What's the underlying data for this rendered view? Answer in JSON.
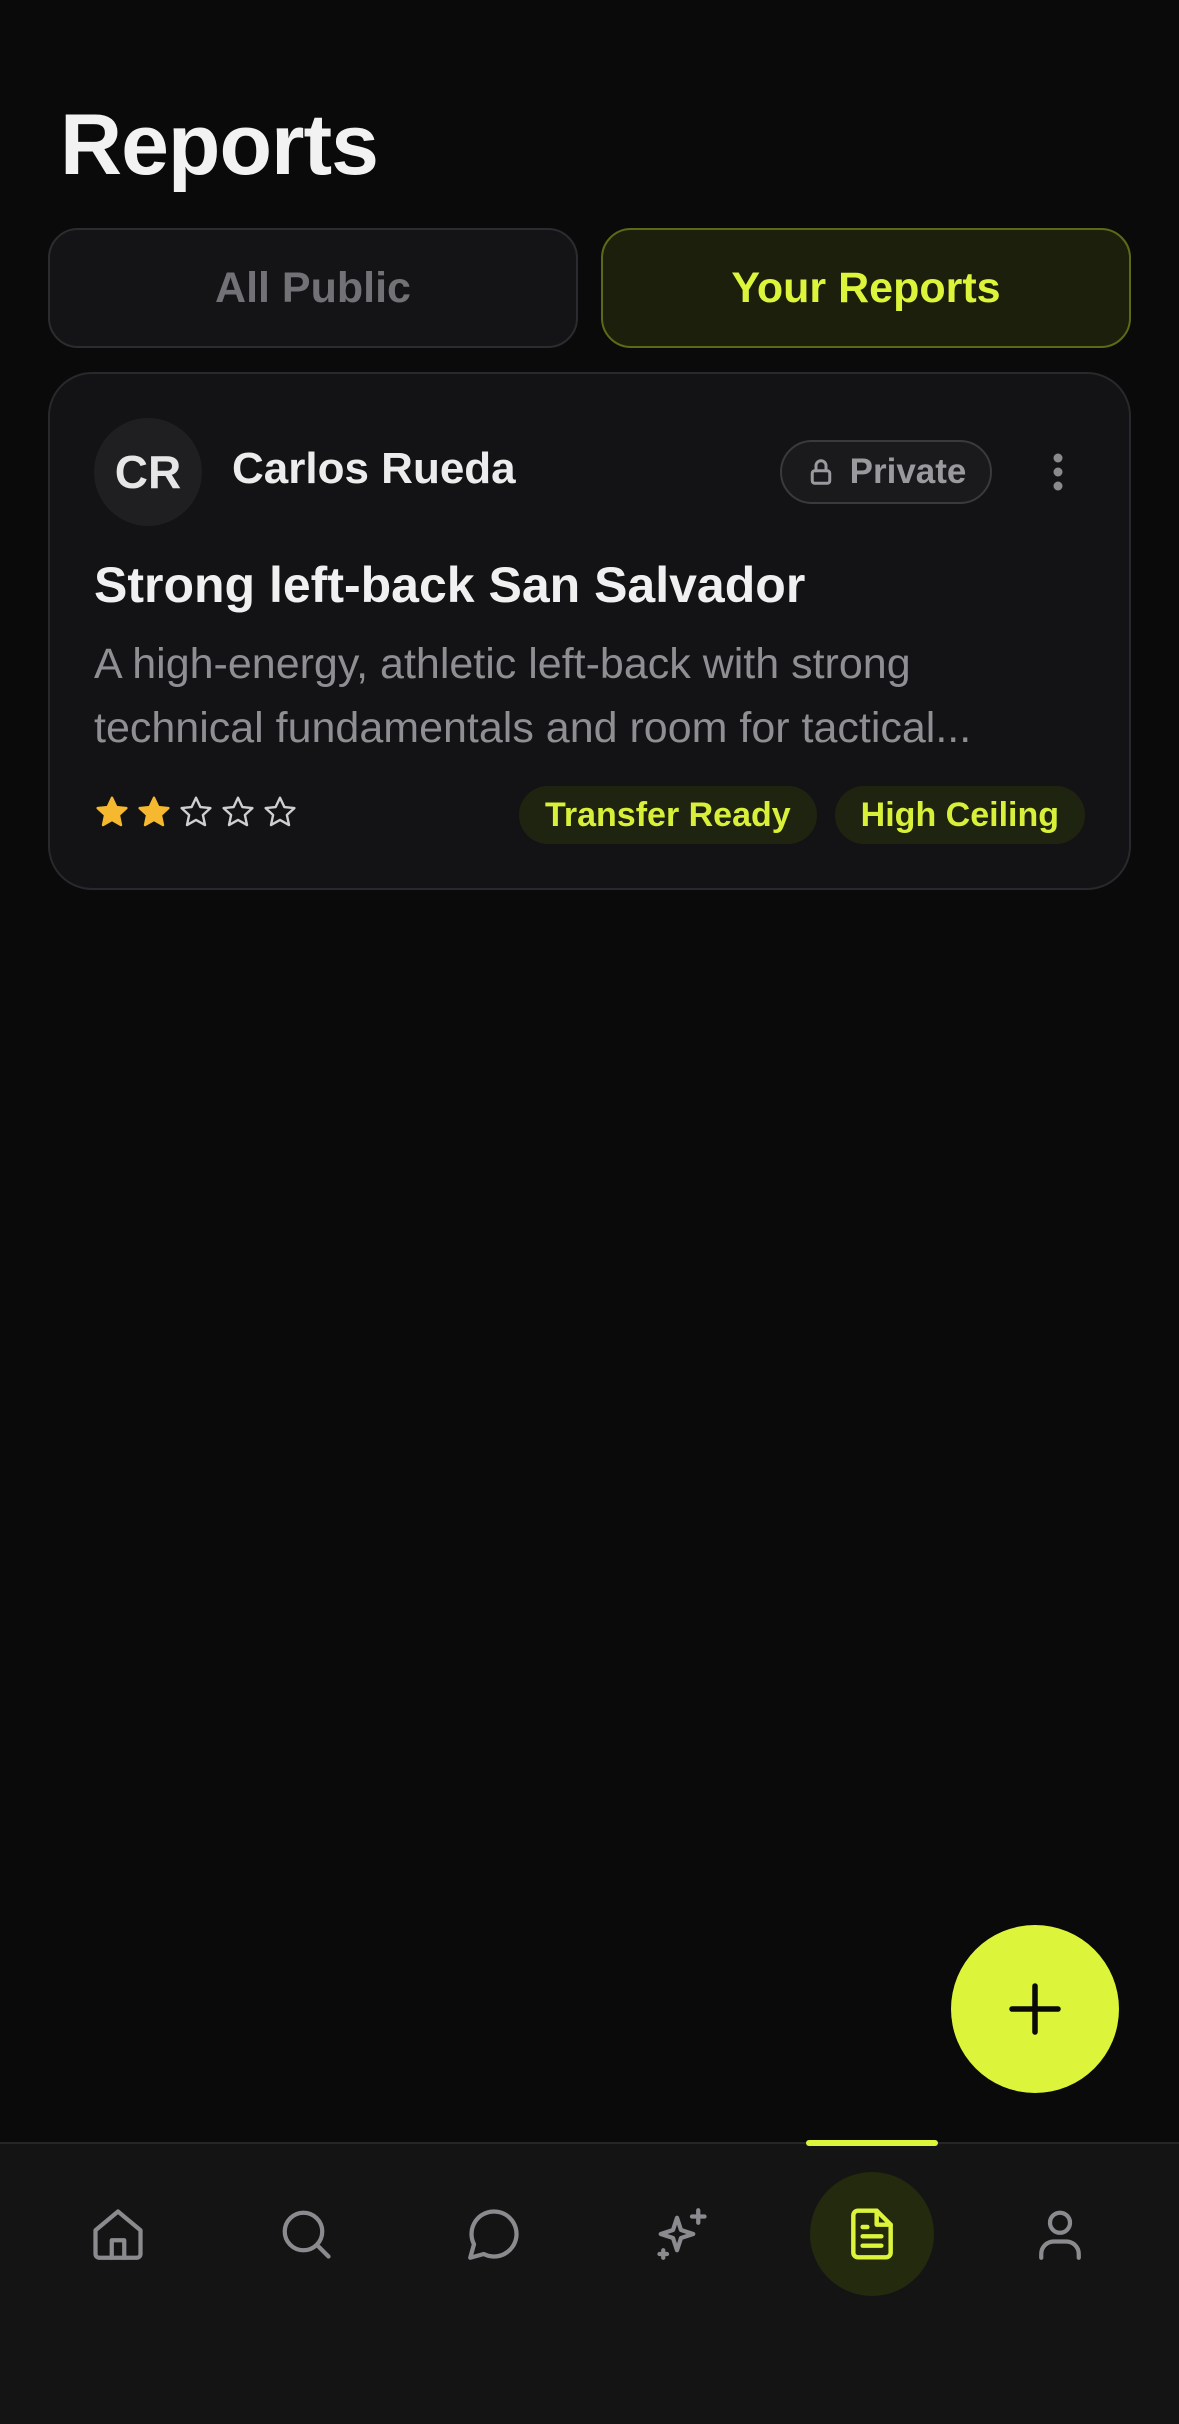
{
  "page": {
    "title": "Reports"
  },
  "tabs": [
    {
      "label": "All Public",
      "active": false
    },
    {
      "label": "Your Reports",
      "active": true
    }
  ],
  "reports": [
    {
      "author_initials": "CR",
      "author_name": "Carlos Rueda",
      "visibility": "Private",
      "title": "Strong left-back San Salvador",
      "description": "A high-energy, athletic left-back with strong technical fundamentals and room for tactical...",
      "rating": 2,
      "rating_max": 5,
      "tags": [
        "Transfer Ready",
        "High Ceiling"
      ]
    }
  ],
  "bottom_nav": {
    "items": [
      {
        "icon": "home-icon",
        "active": false
      },
      {
        "icon": "search-icon",
        "active": false
      },
      {
        "icon": "chat-icon",
        "active": false
      },
      {
        "icon": "sparkles-icon",
        "active": false
      },
      {
        "icon": "document-icon",
        "active": true
      },
      {
        "icon": "profile-icon",
        "active": false
      }
    ]
  },
  "colors": {
    "accent": "#dcf53a",
    "background": "#0a0a0a",
    "card": "#131315",
    "star": "#f5b82e"
  }
}
